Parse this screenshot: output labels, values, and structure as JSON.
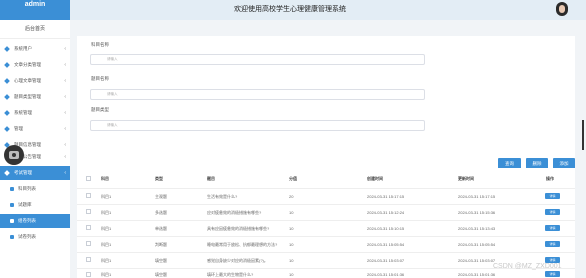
{
  "header": {
    "brand": "admin",
    "title": "欢迎使用高校学生心理健康管理系统"
  },
  "sidebar": {
    "home": "后台首页",
    "items": [
      {
        "label": "系统用户"
      },
      {
        "label": "文章分类管理"
      },
      {
        "label": "心理文章管理"
      },
      {
        "label": "题目类型管理"
      },
      {
        "label": "系统管理"
      },
      {
        "label": "管理"
      },
      {
        "label": "题目信息管理"
      },
      {
        "label": "通知公告管理"
      },
      {
        "label": "考试管理"
      }
    ],
    "sub_items": [
      {
        "label": "科目列表"
      },
      {
        "label": "试题库"
      },
      {
        "label": "组卷列表"
      },
      {
        "label": "试卷列表"
      }
    ]
  },
  "search": {
    "fields": [
      {
        "label": "科目名称",
        "placeholder": "请输入"
      },
      {
        "label": "题目名称",
        "placeholder": "请输入"
      },
      {
        "label": "题目类型",
        "placeholder": "请输入"
      }
    ],
    "buttons": {
      "query": "查询",
      "delete": "删除",
      "add": "添加"
    }
  },
  "table": {
    "headers": [
      "科目",
      "类型",
      "题目",
      "分值",
      "创建时间",
      "更新时间",
      "操作"
    ],
    "rows": [
      {
        "subject": "科目1",
        "type": "主观题",
        "question": "生活有效是什么?",
        "score": "20",
        "created": "2024-03-31 15:17:15",
        "updated": "2024-03-31 15:17:15",
        "action": "详情"
      },
      {
        "subject": "科目1",
        "type": "多选题",
        "question": "应对疲惫效的消极措施有哪些?",
        "score": "10",
        "created": "2024-03-31 15:12:24",
        "updated": "2024-03-31 15:15:36",
        "action": "详情"
      },
      {
        "subject": "科目1",
        "type": "单选题",
        "question": "具有应因疲惫效的消极措施有哪些?",
        "score": "10",
        "created": "2024-03-31 15:10:15",
        "updated": "2024-03-31 15:13:43",
        "action": "详情"
      },
      {
        "subject": "科目1",
        "type": "判断题",
        "question": "睡电最常用于放松、抗郁最理想的方法?",
        "score": "10",
        "created": "2024-03-31 15:05:54",
        "updated": "2024-03-31 15:05:54",
        "action": "详情"
      },
      {
        "subject": "科目1",
        "type": "填空题",
        "question": "感觉自身缺少对应的消极因素(?)。",
        "score": "10",
        "created": "2024-03-31 15:03:07",
        "updated": "2024-03-31 15:03:07",
        "action": "详情"
      },
      {
        "subject": "科目1",
        "type": "填空题",
        "question": "填环上最大的生物是什么?",
        "score": "10",
        "created": "2024-03-31 15:01:36",
        "updated": "2024-03-31 15:01:36",
        "action": "详情"
      }
    ]
  },
  "watermark": "CSDN @MZ_ZXD001",
  "colors": {
    "accent": "#3b8fd6",
    "background": "#f1f4f7"
  }
}
